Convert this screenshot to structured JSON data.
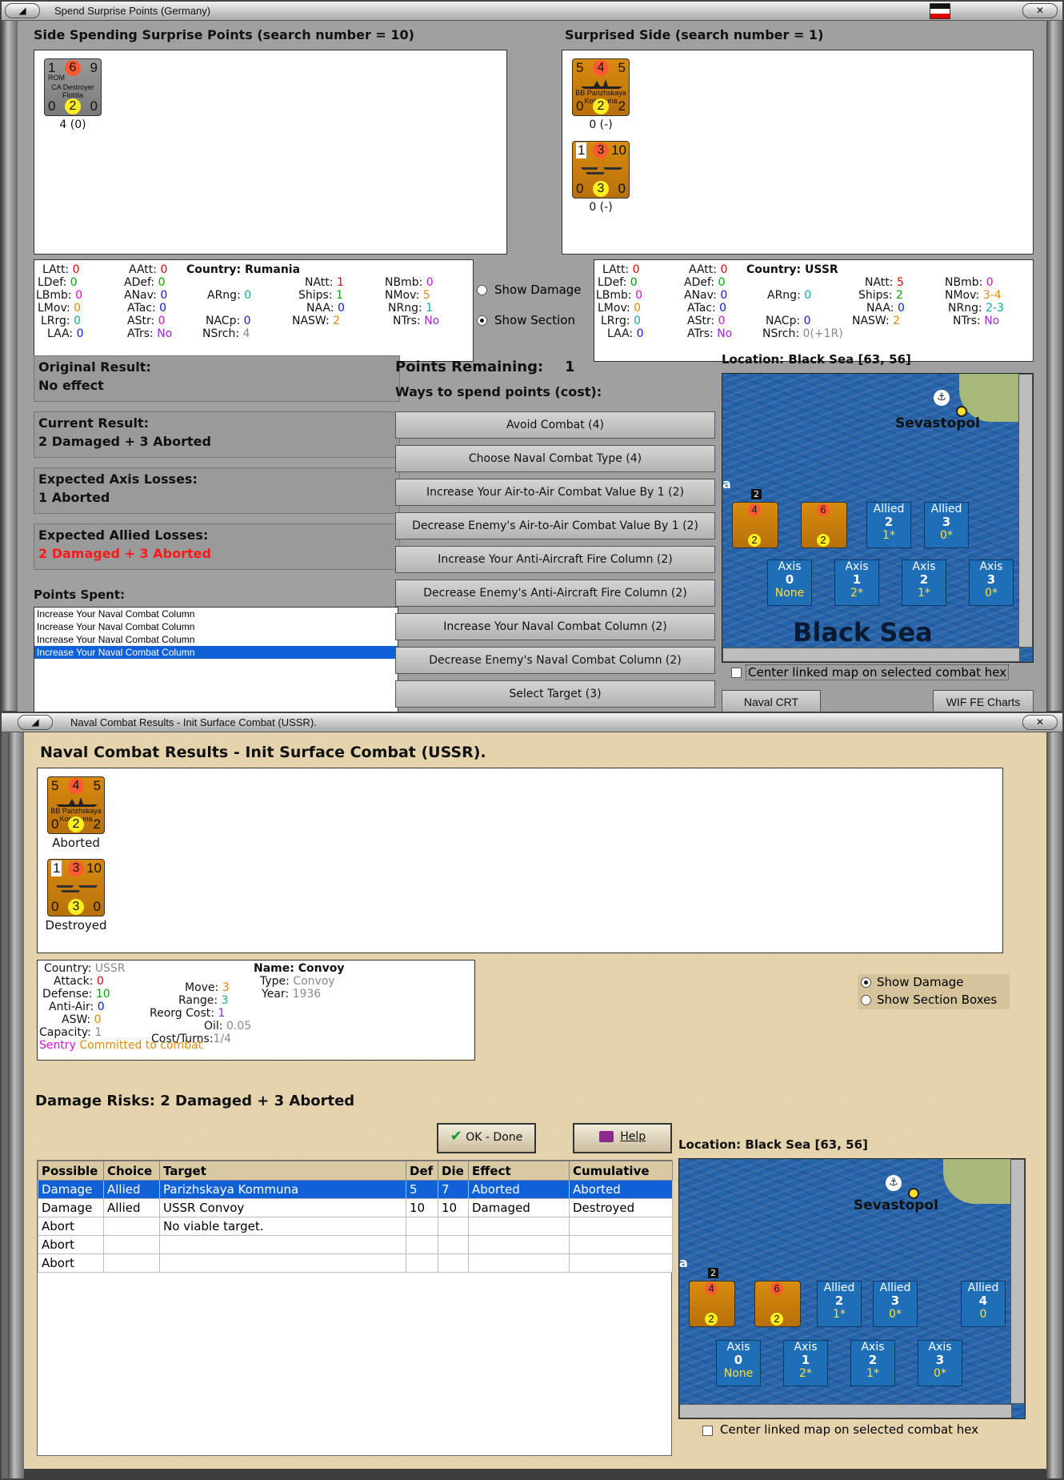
{
  "upper_window": {
    "title": "Spend Surprise Points (Germany)",
    "left_header": "Side Spending Surprise Points (search number = 10)",
    "right_header": "Surprised Side (search number = 1)",
    "left_units": [
      {
        "top_left": "1",
        "top_mid": "6",
        "top_right": "9",
        "nat": "ROM",
        "name": "CA Destroyer Flotilla",
        "bot_left": "0",
        "bot_mid": "2",
        "bot_right": "0",
        "caption": "4 (0)"
      }
    ],
    "right_units": [
      {
        "top_left": "5",
        "top_mid": "4",
        "top_right": "5",
        "name": "BB Parizhskaya Kommuna",
        "bot_left": "0",
        "bot_mid": "2",
        "bot_right": "2",
        "caption": "0 (-)"
      },
      {
        "top_left": "1",
        "top_mid": "3",
        "top_right": "10",
        "name": "",
        "bot_left": "0",
        "bot_mid": "3",
        "bot_right": "0",
        "caption": "0 (-)"
      }
    ],
    "left_stats": {
      "country_label": "Country:",
      "country": "Rumania",
      "LAtt": "0",
      "LDef": "0",
      "LBmb": "0",
      "LMov": "0",
      "LRrg": "0",
      "LAA": "0",
      "AAtt": "0",
      "ADef": "0",
      "ANav": "0",
      "ATac": "0",
      "AStr": "0",
      "ATrs": "No",
      "ARng": "0",
      "NACp": "0",
      "NSrch": "4",
      "NAtt": "1",
      "Ships": "1",
      "NAA": "0",
      "NASW": "2",
      "NBmb": "0",
      "NMov": "5",
      "NRng": "1",
      "NTrs": "No"
    },
    "right_stats": {
      "country_label": "Country:",
      "country": "USSR",
      "LAtt": "0",
      "LDef": "0",
      "LBmb": "0",
      "LMov": "0",
      "LRrg": "0",
      "LAA": "0",
      "AAtt": "0",
      "ADef": "0",
      "ANav": "0",
      "ATac": "0",
      "AStr": "0",
      "ATrs": "No",
      "ARng": "0",
      "NACp": "0",
      "NSrch": "0(+1R)",
      "NAtt": "5",
      "Ships": "2",
      "NAA": "0",
      "NASW": "2",
      "NBmb": "0",
      "NMov": "3-4",
      "NRng": "2-3",
      "NTrs": "No"
    },
    "show_damage": "Show Damage",
    "show_section": "Show Section",
    "original_result_label": "Original Result:",
    "original_result": "No effect",
    "current_result_label": "Current Result:",
    "current_result": "2 Damaged + 3 Aborted",
    "axis_losses_label": "Expected Axis Losses:",
    "axis_losses": "1 Aborted",
    "allied_losses_label": "Expected Allied Losses:",
    "allied_losses": "2 Damaged + 3 Aborted",
    "points_spent_label": "Points Spent:",
    "points_spent": [
      "Increase Your Naval Combat Column",
      "Increase Your Naval Combat Column",
      "Increase Your Naval Combat Column",
      "Increase Your Naval Combat Column"
    ],
    "points_remaining_label": "Points Remaining:",
    "points_remaining": "1",
    "ways_label": "Ways to spend points (cost):",
    "ways": [
      "Avoid Combat (4)",
      "Choose Naval Combat Type (4)",
      "Increase Your Air-to-Air Combat Value By 1 (2)",
      "Decrease Enemy's Air-to-Air Combat Value By 1 (2)",
      "Increase Your Anti-Aircraft Fire Column (2)",
      "Decrease Enemy's Anti-Aircraft Fire Column (2)",
      "Increase Your Naval Combat Column (2)",
      "Decrease Enemy's Naval Combat Column (2)",
      "Select Target (3)"
    ],
    "location_label": "Location: Black Sea [63, 56]",
    "map": {
      "city": "Sevastopol",
      "sea": "Black Sea",
      "hex_marker": "a",
      "stack_count": "2",
      "cells": [
        {
          "t": "Allied",
          "n": "2",
          "s": "1*"
        },
        {
          "t": "Allied",
          "n": "3",
          "s": "0*"
        },
        {
          "t": "Axis",
          "n": "0",
          "s": "None"
        },
        {
          "t": "Axis",
          "n": "1",
          "s": "2*"
        },
        {
          "t": "Axis",
          "n": "2",
          "s": "1*"
        },
        {
          "t": "Axis",
          "n": "3",
          "s": "0*"
        }
      ]
    },
    "center_linked": "Center linked map on selected combat hex",
    "naval_crt": "Naval CRT",
    "wif_charts": "WIF FE Charts"
  },
  "lower_window": {
    "title": "Naval Combat Results - Init Surface Combat (USSR).",
    "heading": "Naval Combat Results - Init Surface Combat (USSR).",
    "units": [
      {
        "top_left": "5",
        "top_mid": "4",
        "top_right": "5",
        "name": "BB Parizhskaya Kommuna",
        "bot_left": "0",
        "bot_mid": "2",
        "bot_right": "2",
        "caption": "Aborted"
      },
      {
        "top_left": "1",
        "top_mid": "3",
        "top_right": "10",
        "name": "",
        "bot_left": "0",
        "bot_mid": "3",
        "bot_right": "0",
        "caption": "Destroyed"
      }
    ],
    "info": {
      "country_label": "Country:",
      "country": "USSR",
      "attack_label": "Attack:",
      "attack": "0",
      "defense_label": "Defense:",
      "defense": "10",
      "antiair_label": "Anti-Air:",
      "antiair": "0",
      "asw_label": "ASW:",
      "asw": "0",
      "capacity_label": "Capacity:",
      "capacity": "1",
      "move_label": "Move:",
      "move": "3",
      "range_label": "Range:",
      "range": "3",
      "reorg_label": "Reorg Cost:",
      "reorg": "1",
      "oil_label": "Oil:",
      "oil": "0.05",
      "cost_label": "Cost/Turns:",
      "cost": "1/4",
      "name_label": "Name:",
      "name": "Convoy",
      "type_label": "Type:",
      "type": "Convoy",
      "year_label": "Year:",
      "year": "1936",
      "sentry": "Sentry",
      "committed": "Committed to combat"
    },
    "show_damage": "Show Damage",
    "show_section_boxes": "Show Section Boxes",
    "damage_risks": "Damage Risks:  2 Damaged + 3 Aborted",
    "ok_done": "OK - Done",
    "help": "Help",
    "table_headers": [
      "Possible",
      "Choice",
      "Target",
      "Def",
      "Die",
      "Effect",
      "Cumulative"
    ],
    "table_rows": [
      [
        "Damage",
        "Allied",
        "Parizhskaya Kommuna",
        "5",
        "7",
        "Aborted",
        "Aborted"
      ],
      [
        "Damage",
        "Allied",
        "USSR Convoy",
        "10",
        "10",
        "Damaged",
        "Destroyed"
      ],
      [
        "Abort",
        "",
        "No viable target.",
        "",
        "",
        "",
        ""
      ],
      [
        "Abort",
        "",
        "",
        "",
        "",
        "",
        ""
      ],
      [
        "Abort",
        "",
        "",
        "",
        "",
        "",
        ""
      ]
    ],
    "location_label": "Location:  Black Sea [63, 56]",
    "map": {
      "city": "Sevastopol",
      "hex_marker": "a",
      "stack_count": "2",
      "cells": [
        {
          "t": "Allied",
          "n": "2",
          "s": "1*"
        },
        {
          "t": "Allied",
          "n": "3",
          "s": "0*"
        },
        {
          "t": "Allied",
          "n": "4",
          "s": "0"
        },
        {
          "t": "Axis",
          "n": "0",
          "s": "None"
        },
        {
          "t": "Axis",
          "n": "1",
          "s": "2*"
        },
        {
          "t": "Axis",
          "n": "2",
          "s": "1*"
        },
        {
          "t": "Axis",
          "n": "3",
          "s": "0*"
        }
      ]
    },
    "center_linked": "Center linked map on selected combat hex"
  },
  "colors": {
    "selection": "#1060d8",
    "counter_orange": "#d88b0e",
    "allied_loss": "#ff1a1a",
    "map_sea": "#2763a8"
  }
}
